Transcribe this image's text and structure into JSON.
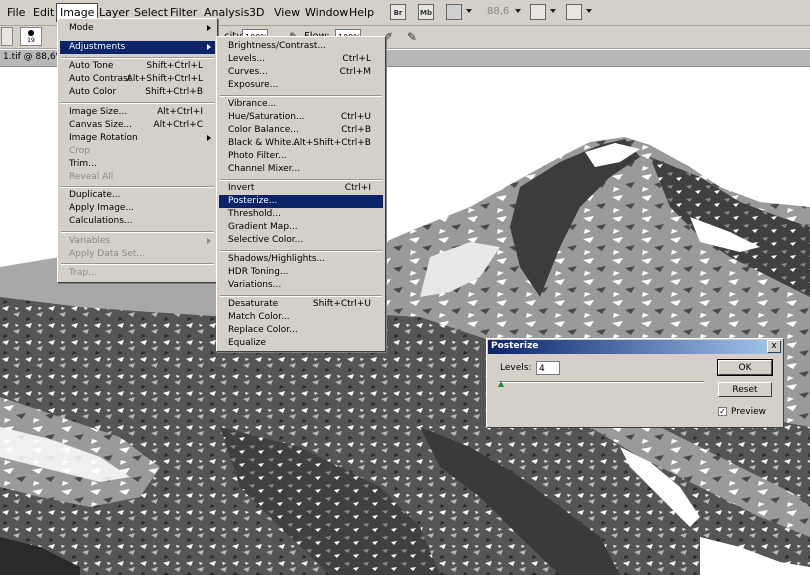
{
  "menubar": {
    "items": [
      "File",
      "Edit",
      "Image",
      "Layer",
      "Select",
      "Filter",
      "Analysis",
      "3D",
      "View",
      "Window",
      "Help"
    ],
    "icons": [
      "Br",
      "Mb"
    ],
    "zoom": "88,6"
  },
  "optbar": {
    "brush_size": "19",
    "opacity_label": "city:",
    "opacity_value": "100%",
    "flow_label": "Flow:",
    "flow_value": "100%"
  },
  "doc": {
    "tab_title": "1.tif @ 88,6%"
  },
  "image_menu": {
    "items": [
      {
        "label": "Mode",
        "shortcut": ""
      },
      {
        "label": "Adjustments",
        "shortcut": ""
      },
      {
        "label": "Auto Tone",
        "shortcut": "Shift+Ctrl+L"
      },
      {
        "label": "Auto Contrast",
        "shortcut": "Alt+Shift+Ctrl+L"
      },
      {
        "label": "Auto Color",
        "shortcut": "Shift+Ctrl+B"
      },
      {
        "label": "Image Size...",
        "shortcut": "Alt+Ctrl+I"
      },
      {
        "label": "Canvas Size...",
        "shortcut": "Alt+Ctrl+C"
      },
      {
        "label": "Image Rotation",
        "shortcut": ""
      },
      {
        "label": "Crop",
        "shortcut": ""
      },
      {
        "label": "Trim...",
        "shortcut": ""
      },
      {
        "label": "Reveal All",
        "shortcut": ""
      },
      {
        "label": "Duplicate...",
        "shortcut": ""
      },
      {
        "label": "Apply Image...",
        "shortcut": ""
      },
      {
        "label": "Calculations...",
        "shortcut": ""
      },
      {
        "label": "Variables",
        "shortcut": ""
      },
      {
        "label": "Apply Data Set...",
        "shortcut": ""
      },
      {
        "label": "Trap...",
        "shortcut": ""
      }
    ]
  },
  "adjustments_menu": {
    "items": [
      {
        "label": "Brightness/Contrast...",
        "shortcut": ""
      },
      {
        "label": "Levels...",
        "shortcut": "Ctrl+L"
      },
      {
        "label": "Curves...",
        "shortcut": "Ctrl+M"
      },
      {
        "label": "Exposure...",
        "shortcut": ""
      },
      {
        "label": "Vibrance...",
        "shortcut": ""
      },
      {
        "label": "Hue/Saturation...",
        "shortcut": "Ctrl+U"
      },
      {
        "label": "Color Balance...",
        "shortcut": "Ctrl+B"
      },
      {
        "label": "Black & White...",
        "shortcut": "Alt+Shift+Ctrl+B"
      },
      {
        "label": "Photo Filter...",
        "shortcut": ""
      },
      {
        "label": "Channel Mixer...",
        "shortcut": ""
      },
      {
        "label": "Invert",
        "shortcut": "Ctrl+I"
      },
      {
        "label": "Posterize...",
        "shortcut": ""
      },
      {
        "label": "Threshold...",
        "shortcut": ""
      },
      {
        "label": "Gradient Map...",
        "shortcut": ""
      },
      {
        "label": "Selective Color...",
        "shortcut": ""
      },
      {
        "label": "Shadows/Highlights...",
        "shortcut": ""
      },
      {
        "label": "HDR Toning...",
        "shortcut": ""
      },
      {
        "label": "Variations...",
        "shortcut": ""
      },
      {
        "label": "Desaturate",
        "shortcut": "Shift+Ctrl+U"
      },
      {
        "label": "Match Color...",
        "shortcut": ""
      },
      {
        "label": "Replace Color...",
        "shortcut": ""
      },
      {
        "label": "Equalize",
        "shortcut": ""
      }
    ]
  },
  "posterize_dialog": {
    "title": "Posterize",
    "close": "x",
    "levels_label": "Levels:",
    "levels_value": "4",
    "ok_label": "OK",
    "reset_label": "Reset",
    "preview_label": "Preview",
    "preview_checked": true
  },
  "colors": {
    "highlight": "#0a246a",
    "chrome": "#d4d0c8"
  }
}
